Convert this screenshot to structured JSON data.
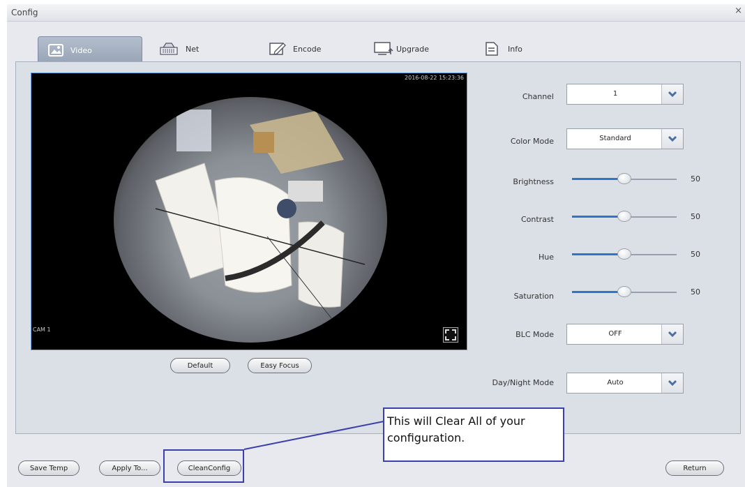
{
  "window": {
    "title": "Config",
    "close_label": "×"
  },
  "tabs": [
    {
      "label": "Video",
      "icon": "video-icon"
    },
    {
      "label": "Net",
      "icon": "network-icon"
    },
    {
      "label": "Encode",
      "icon": "encode-icon"
    },
    {
      "label": "Upgrade",
      "icon": "upgrade-icon"
    },
    {
      "label": "Info",
      "icon": "info-icon"
    }
  ],
  "video": {
    "timestamp": "2016-08-22 15:23:36",
    "camera_label": "CAM 1"
  },
  "buttons": {
    "default": "Default",
    "easy_focus": "Easy Focus",
    "save_temp": "Save Temp",
    "apply_to": "Apply To...",
    "clean_config": "CleanConfig",
    "return": "Return"
  },
  "settings": {
    "channel": {
      "label": "Channel",
      "value": "1"
    },
    "color_mode": {
      "label": "Color Mode",
      "value": "Standard"
    },
    "brightness": {
      "label": "Brightness",
      "value": "50"
    },
    "contrast": {
      "label": "Contrast",
      "value": "50"
    },
    "hue": {
      "label": "Hue",
      "value": "50"
    },
    "saturation": {
      "label": "Saturation",
      "value": "50"
    },
    "blc_mode": {
      "label": "BLC Mode",
      "value": "OFF"
    },
    "day_night_mode": {
      "label": "Day/Night Mode",
      "value": "Auto"
    }
  },
  "slider_level_percent": 50,
  "callout": {
    "text": "This will Clear All of your configuration."
  },
  "colors": {
    "accent": "#2e75c9",
    "callout_border": "#3b3fae",
    "panel": "#dbdfe6"
  }
}
